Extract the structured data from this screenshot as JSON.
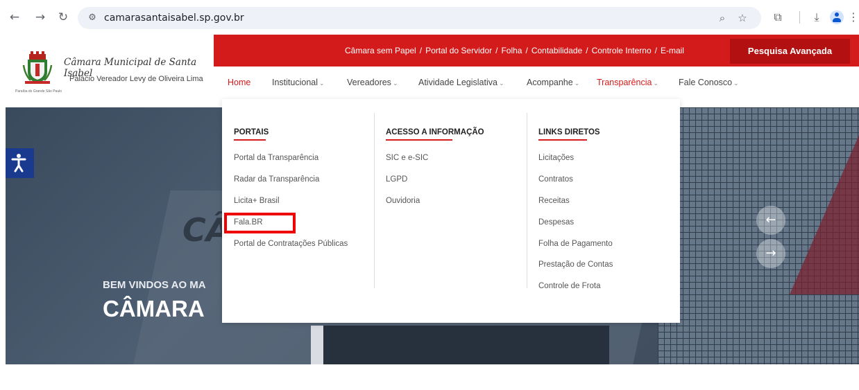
{
  "browser": {
    "url": "camarasantaisabel.sp.gov.br",
    "icons": [
      "back-icon",
      "forward-icon",
      "reload-icon",
      "site-info-icon",
      "zoom-icon",
      "bookmark-star-icon",
      "extensions-icon",
      "download-icon",
      "profile-avatar",
      "more-menu-icon"
    ]
  },
  "header": {
    "brand_title": "Câmara Municipal de Santa Isabel",
    "brand_subtitle": "Palácio Vereador Levy de Oliveira Lima",
    "crest_caption": "Paraíba do Grande São Paulo",
    "quick_links": [
      "Câmara sem Papel",
      "Portal do Servidor",
      "Folha",
      "Contabilidade",
      "Controle Interno",
      "E-mail"
    ],
    "quick_link_separator": "/",
    "search_button": "Pesquisa Avançada",
    "menu": [
      {
        "label": "Home",
        "active": true,
        "has_submenu": false
      },
      {
        "label": "Institucional",
        "active": false,
        "has_submenu": true
      },
      {
        "label": "Vereadores",
        "active": false,
        "has_submenu": true
      },
      {
        "label": "Atividade Legislativa",
        "active": false,
        "has_submenu": true
      },
      {
        "label": "Acompanhe",
        "active": false,
        "has_submenu": true
      },
      {
        "label": "Transparência",
        "active": true,
        "has_submenu": true
      },
      {
        "label": "Fale Conosco",
        "active": false,
        "has_submenu": true
      }
    ]
  },
  "hero": {
    "welcome": "BEM VINDOS AO MA",
    "title": "CÂMARA",
    "sign_text": "CÂ",
    "prev_icon": "arrow-left-icon",
    "next_icon": "arrow-right-icon"
  },
  "dropdown": {
    "columns": [
      {
        "heading": "PORTAIS",
        "links": [
          "Portal da Transparência",
          "Radar da Transparência",
          "Licita+ Brasil",
          "Fala.BR",
          "Portal de Contratações Públicas"
        ]
      },
      {
        "heading": "ACESSO A INFORMAÇÃO",
        "links": [
          "SIC e e-SIC",
          "LGPD",
          "Ouvidoria"
        ]
      },
      {
        "heading": "LINKS DIRETOS",
        "links": [
          "Licitações",
          "Contratos",
          "Receitas",
          "Despesas",
          "Folha de Pagamento",
          "Prestação de Contas",
          "Controle de Frota"
        ]
      }
    ],
    "highlighted_link": "Fala.BR"
  },
  "colors": {
    "brand_red": "#d41b1b",
    "search_button_red": "#b31111",
    "accessibility_blue": "#1a3a8f",
    "highlight_box": "#ee0000"
  }
}
